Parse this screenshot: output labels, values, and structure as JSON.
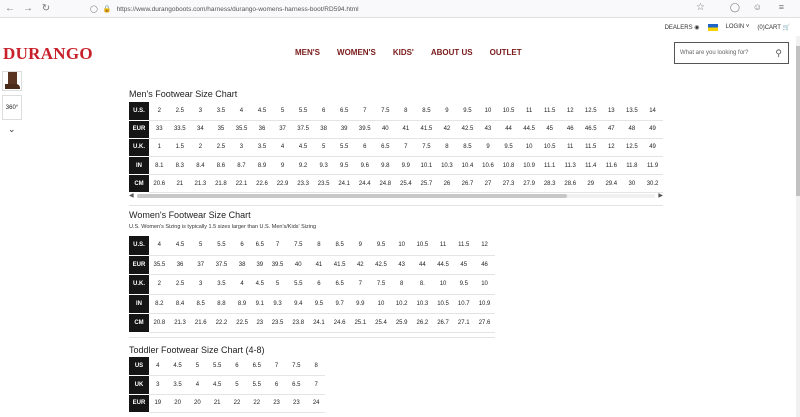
{
  "browser": {
    "url": "https://www.durangoboots.com/harness/durango-womens-harness-boot/RD594.html"
  },
  "util": {
    "dealers": "DEALERS",
    "login": "LOGIN",
    "cart": "(0)CART"
  },
  "header": {
    "logo": "DURANGO",
    "nav": [
      "MEN'S",
      "WOMEN'S",
      "KIDS'",
      "ABOUT US",
      "OUTLET"
    ],
    "search_placeholder": "What are you looking for?"
  },
  "thumbs": {
    "view360": "360°"
  },
  "mens": {
    "title": "Men's Footwear Size Chart",
    "rows": [
      {
        "label": "U.S.",
        "cells": [
          "2",
          "2.5",
          "3",
          "3.5",
          "4",
          "4.5",
          "5",
          "5.5",
          "6",
          "6.5",
          "7",
          "7.5",
          "8",
          "8.5",
          "9",
          "9.5",
          "10",
          "10.5",
          "11",
          "11.5",
          "12",
          "12.5",
          "13",
          "13.5",
          "14"
        ]
      },
      {
        "label": "EUR",
        "cells": [
          "33",
          "33.5",
          "34",
          "35",
          "35.5",
          "36",
          "37",
          "37.5",
          "38",
          "39",
          "39.5",
          "40",
          "41",
          "41.5",
          "42",
          "42.5",
          "43",
          "44",
          "44.5",
          "45",
          "46",
          "46.5",
          "47",
          "48",
          "49"
        ]
      },
      {
        "label": "U.K.",
        "cells": [
          "1",
          "1.5",
          "2",
          "2.5",
          "3",
          "3.5",
          "4",
          "4.5",
          "5",
          "5.5",
          "6",
          "6.5",
          "7",
          "7.5",
          "8",
          "8.5",
          "9",
          "9.5",
          "10",
          "10.5",
          "11",
          "11.5",
          "12",
          "12.5",
          "49"
        ]
      },
      {
        "label": "IN",
        "cells": [
          "8.1",
          "8.3",
          "8.4",
          "8.6",
          "8.7",
          "8.9",
          "9",
          "9.2",
          "9.3",
          "9.5",
          "9.6",
          "9.8",
          "9.9",
          "10.1",
          "10.3",
          "10.4",
          "10.6",
          "10.8",
          "10.9",
          "11.1",
          "11.3",
          "11.4",
          "11.6",
          "11.8",
          "11.9"
        ]
      },
      {
        "label": "CM",
        "cells": [
          "20.6",
          "21",
          "21.3",
          "21.8",
          "22.1",
          "22.6",
          "22.9",
          "23.3",
          "23.5",
          "24.1",
          "24.4",
          "24.8",
          "25.4",
          "25.7",
          "26",
          "26.7",
          "27",
          "27.3",
          "27.9",
          "28.3",
          "28.6",
          "29",
          "29.4",
          "30",
          "30.2"
        ]
      }
    ]
  },
  "womens": {
    "title": "Women's Footwear Size Chart",
    "note": "U.S. Women's Sizing is typically 1.5 sizes larger than U.S. Men's/Kids' Sizing",
    "rows": [
      {
        "label": "U.S.",
        "cells": [
          "4",
          "4.5",
          "5",
          "5.5",
          "6",
          "6.5",
          "7",
          "7.5",
          "8",
          "8.5",
          "9",
          "9.5",
          "10",
          "10.5",
          "11",
          "11.5",
          "12"
        ]
      },
      {
        "label": "EUR",
        "cells": [
          "35.5",
          "36",
          "37",
          "37.5",
          "38",
          "39",
          "39.5",
          "40",
          "41",
          "41.5",
          "42",
          "42.5",
          "43",
          "44",
          "44.5",
          "45",
          "46"
        ]
      },
      {
        "label": "U.K.",
        "cells": [
          "2",
          "2.5",
          "3",
          "3.5",
          "4",
          "4.5",
          "5",
          "5.5",
          "6",
          "6.5",
          "7",
          "7.5",
          "8",
          "8.",
          "10",
          "9.5",
          "10"
        ]
      },
      {
        "label": "IN",
        "cells": [
          "8.2",
          "8.4",
          "8.5",
          "8.8",
          "8.9",
          "9.1",
          "9.3",
          "9.4",
          "9.5",
          "9.7",
          "9.9",
          "10",
          "10.2",
          "10.3",
          "10.5",
          "10.7",
          "10.9"
        ]
      },
      {
        "label": "CM",
        "cells": [
          "20.8",
          "21.3",
          "21.6",
          "22.2",
          "22.5",
          "23",
          "23.5",
          "23.8",
          "24.1",
          "24.6",
          "25.1",
          "25.4",
          "25.9",
          "26.2",
          "26.7",
          "27.1",
          "27.6"
        ]
      }
    ]
  },
  "toddler": {
    "title": "Toddler Footwear Size Chart (4-8)",
    "rows": [
      {
        "label": "US",
        "cells": [
          "4",
          "4.5",
          "5",
          "5.5",
          "6",
          "6.5",
          "7",
          "7.5",
          "8"
        ]
      },
      {
        "label": "UK",
        "cells": [
          "3",
          "3.5",
          "4",
          "4.5",
          "5",
          "5.5",
          "6",
          "6.5",
          "7"
        ]
      },
      {
        "label": "EUR",
        "cells": [
          "19",
          "20",
          "20",
          "21",
          "22",
          "22",
          "23",
          "23",
          "24"
        ]
      }
    ]
  }
}
